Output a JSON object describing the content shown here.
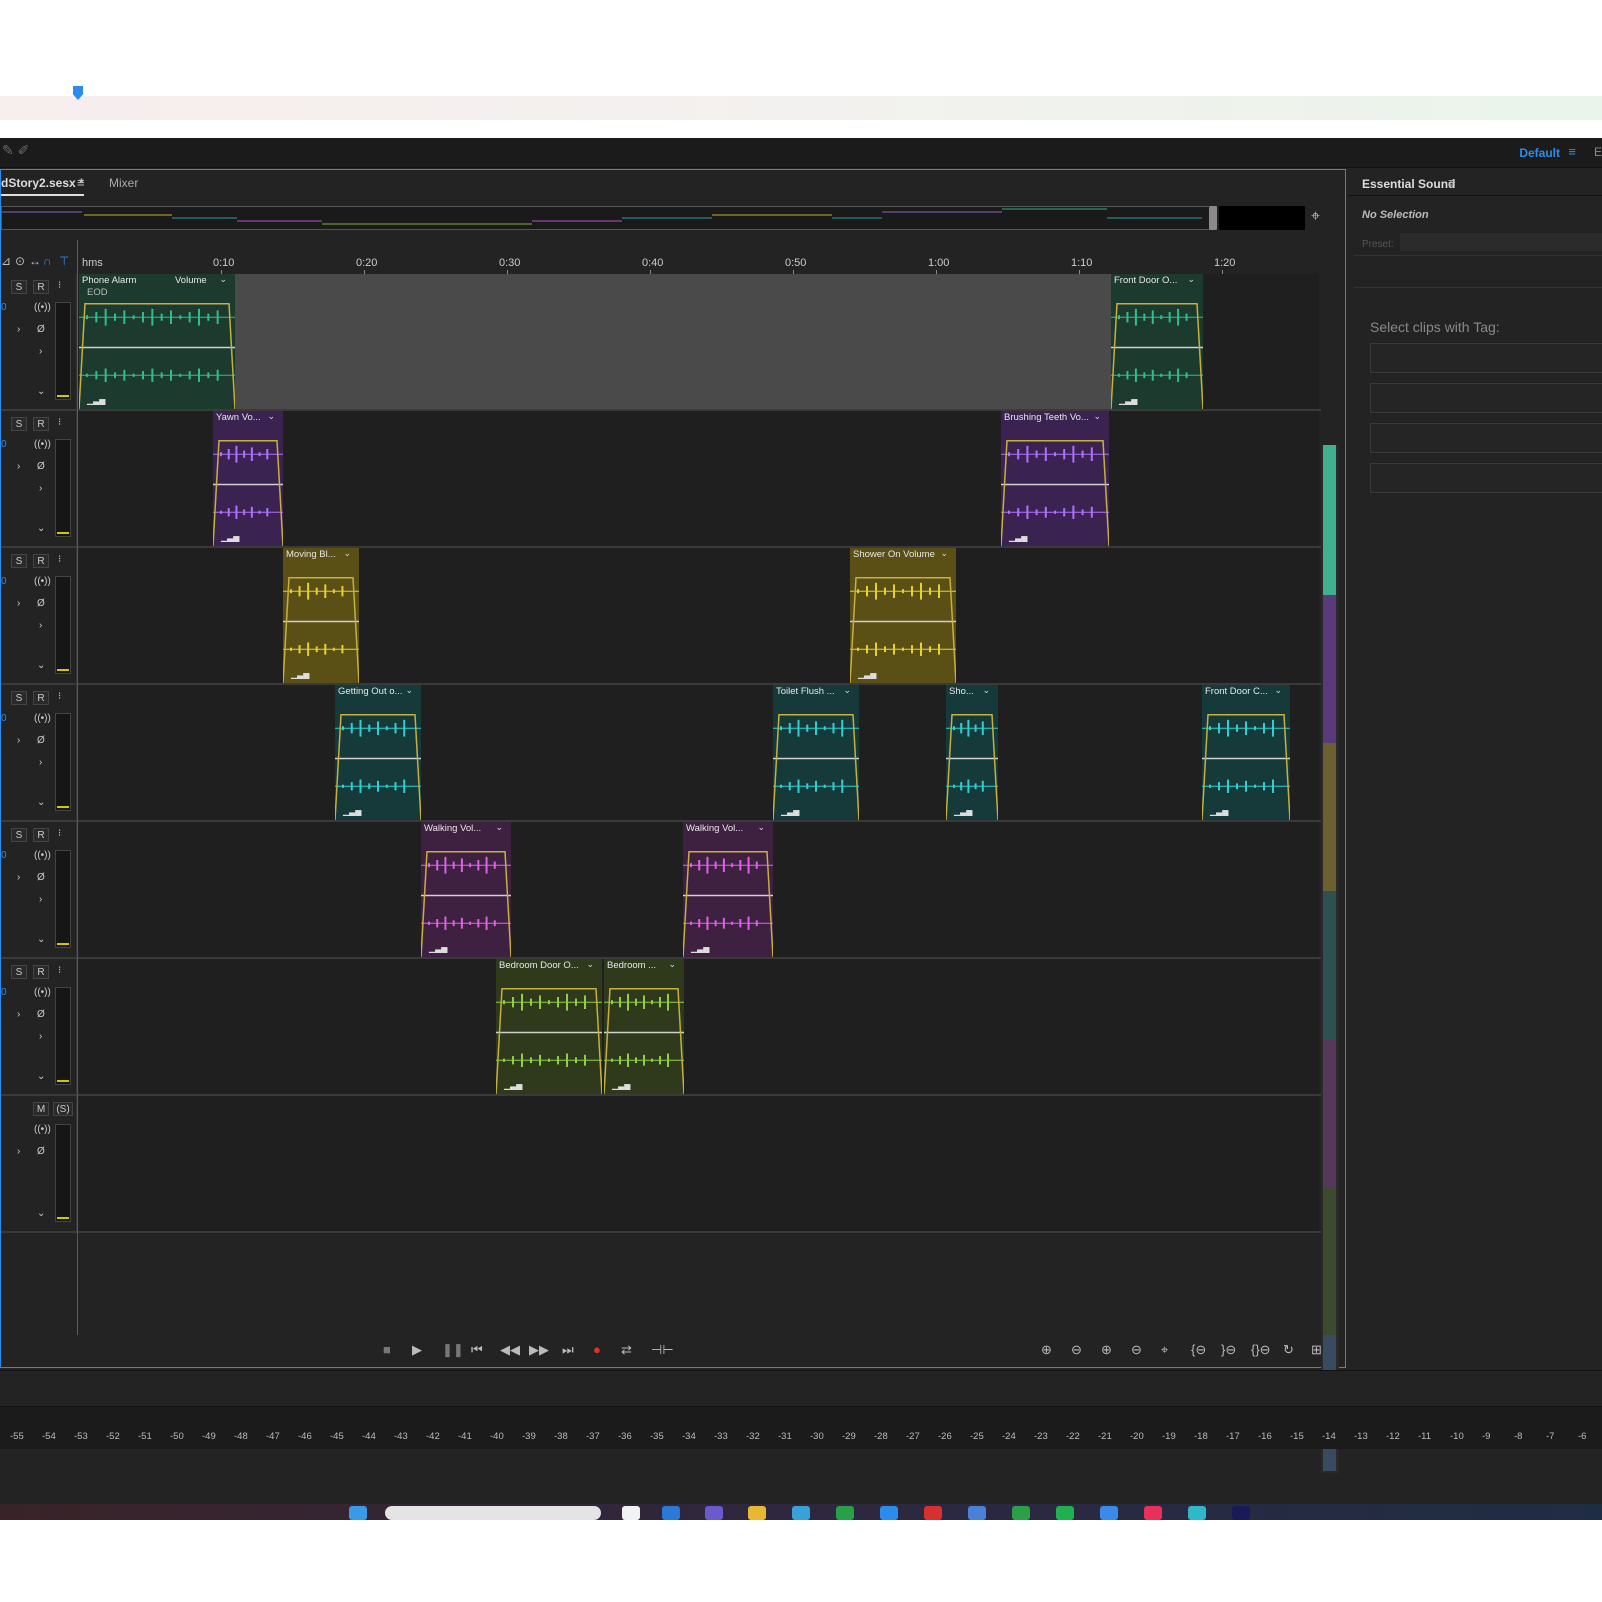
{
  "workspace": {
    "name": "Default",
    "extra": "E"
  },
  "editor_tab": {
    "title": "dStory2.sesx *",
    "mixer": "Mixer"
  },
  "ruler": {
    "unit": "hms",
    "ticks": [
      "0:10",
      "0:20",
      "0:30",
      "0:40",
      "0:50",
      "1:00",
      "1:10",
      "1:20"
    ]
  },
  "track_labels": {
    "s": "S",
    "r": "R",
    "m": "M",
    "s_paren": "(S)",
    "input_zero": "0"
  },
  "clips": [
    {
      "track": 0,
      "label": "Phone Alarm",
      "vol": "Volume",
      "sub": "EOD",
      "color": "#1d3a2e",
      "wave": "#2fc08a"
    },
    {
      "track": 0,
      "label": "Front Door O...",
      "color": "#1d3a2e",
      "wave": "#2fc08a"
    },
    {
      "track": 1,
      "label": "Yawn Vo...",
      "color": "#3a2350",
      "wave": "#b070ff"
    },
    {
      "track": 1,
      "label": "Brushing Teeth Vo...",
      "color": "#3a2350",
      "wave": "#b070ff"
    },
    {
      "track": 2,
      "label": "Moving Bl...",
      "color": "#5a4f15",
      "wave": "#e8d030"
    },
    {
      "track": 2,
      "label": "Shower On Volume",
      "color": "#5a4f15",
      "wave": "#e8d030"
    },
    {
      "track": 3,
      "label": "Getting Out o...",
      "color": "#163a3a",
      "wave": "#30d0d0"
    },
    {
      "track": 3,
      "label": "Toilet Flush ...",
      "color": "#163a3a",
      "wave": "#30d0d0"
    },
    {
      "track": 3,
      "label": "Sho...",
      "color": "#163a3a",
      "wave": "#30d0d0"
    },
    {
      "track": 3,
      "label": "Front Door C...",
      "color": "#163a3a",
      "wave": "#30d0d0"
    },
    {
      "track": 4,
      "label": "Walking Vol...",
      "color": "#3e2040",
      "wave": "#e060e8"
    },
    {
      "track": 4,
      "label": "Walking Vol...",
      "color": "#3e2040",
      "wave": "#e060e8"
    },
    {
      "track": 5,
      "label": "Bedroom Door O...",
      "color": "#2f3a1c",
      "wave": "#8fd040"
    },
    {
      "track": 5,
      "label": "Bedroom ...",
      "color": "#2f3a1c",
      "wave": "#8fd040"
    }
  ],
  "essential_sound": {
    "title": "Essential Sound",
    "no_selection": "No Selection",
    "preset": "Preset:",
    "tag_prompt": "Select clips with Tag:"
  },
  "level_scale": [
    "-55",
    "-54",
    "-53",
    "-52",
    "-51",
    "-50",
    "-49",
    "-48",
    "-47",
    "-46",
    "-45",
    "-44",
    "-43",
    "-42",
    "-41",
    "-40",
    "-39",
    "-38",
    "-37",
    "-36",
    "-35",
    "-34",
    "-33",
    "-32",
    "-31",
    "-30",
    "-29",
    "-28",
    "-27",
    "-26",
    "-25",
    "-24",
    "-23",
    "-22",
    "-21",
    "-20",
    "-19",
    "-18",
    "-17",
    "-16",
    "-15",
    "-14",
    "-13",
    "-12",
    "-11",
    "-10",
    "-9",
    "-8",
    "-7",
    "-6"
  ],
  "colors": {
    "accent": "#2d8ceb",
    "playhead": "#c0302c",
    "panel": "#232323"
  }
}
